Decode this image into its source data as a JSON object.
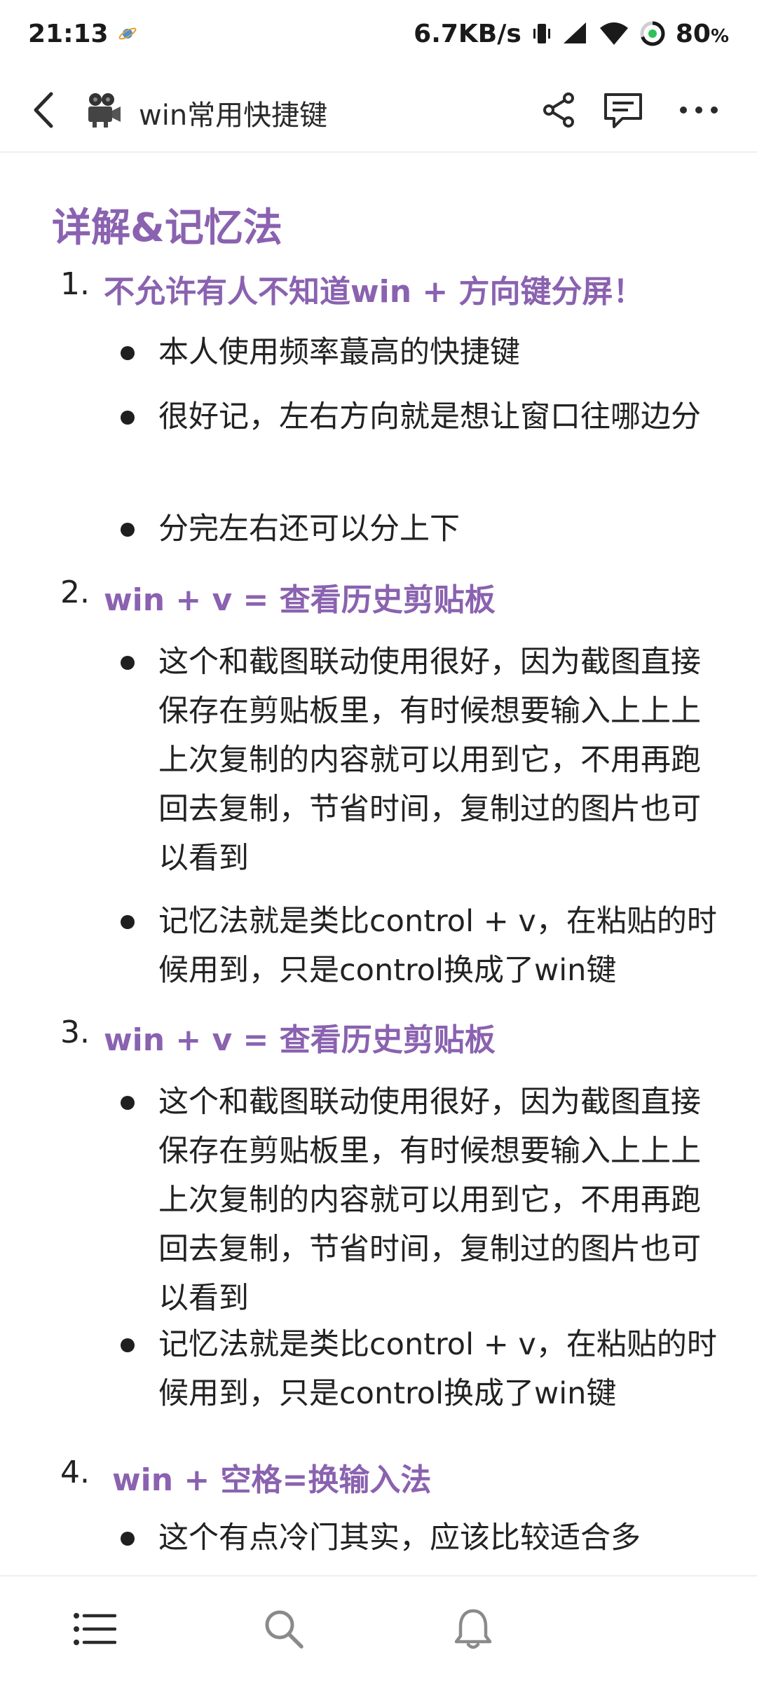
{
  "status_bar": {
    "time": "21:13",
    "network_speed": "6.7KB/s",
    "battery": "80",
    "battery_unit": "%"
  },
  "header": {
    "title": "win常用快捷键",
    "doc_icon": "movie-camera-icon"
  },
  "content": {
    "heading": "详解&记忆法",
    "items": [
      {
        "number": "1.",
        "title": "不允许有人不知道win + 方向键分屏！",
        "bullets": [
          "本人使用频率蕞高的快捷键",
          "很好记，左右方向就是想让窗口往哪边分",
          "分完左右还可以分上下"
        ]
      },
      {
        "number": "2.",
        "title": "win + v = 查看历史剪贴板",
        "bullets": [
          "这个和截图联动使用很好，因为截图直接保存在剪贴板里，有时候想要输入上上上上次复制的内容就可以用到它，不用再跑回去复制，节省时间，复制过的图片也可以看到",
          "记忆法就是类比control + v，在粘贴的时候用到，只是control换成了win键"
        ]
      },
      {
        "number": "3.",
        "title": "win + v = 查看历史剪贴板",
        "bullets": [
          "这个和截图联动使用很好，因为截图直接保存在剪贴板里，有时候想要输入上上上上次复制的内容就可以用到它，不用再跑回去复制，节省时间，复制过的图片也可以看到",
          "记忆法就是类比control + v，在粘贴的时候用到，只是control换成了win键"
        ]
      },
      {
        "number": "4.",
        "title": "win + 空格=换输入法",
        "bullets": [
          "这个有点冷门其实，应该比较适合多"
        ]
      }
    ]
  },
  "colors": {
    "accent": "#8a62b0",
    "text": "#222222"
  }
}
